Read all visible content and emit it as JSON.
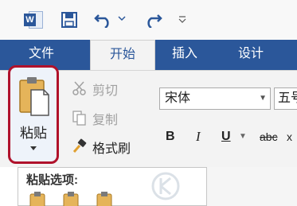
{
  "qat": {
    "app_icon": "word-icon",
    "app_icon_letter": "W",
    "save_icon": "save-icon",
    "undo_icon": "undo-icon",
    "redo_icon": "redo-icon",
    "more_icon": "customize-qat-icon"
  },
  "tabs": [
    {
      "label": "文件"
    },
    {
      "label": "开始"
    },
    {
      "label": "插入"
    },
    {
      "label": "设计"
    }
  ],
  "clipboard": {
    "paste_label": "粘贴",
    "cut_label": "剪切",
    "copy_label": "复制",
    "format_painter_label": "格式刷"
  },
  "font": {
    "name": "宋体",
    "size": "五号",
    "bold": "B",
    "italic": "I",
    "underline": "U",
    "strikethrough": "abc",
    "more": "x"
  },
  "paste_options": {
    "title": "粘贴选项:"
  },
  "colors": {
    "brand": "#2b579a",
    "highlight_border": "#b0122b",
    "ribbon": "#f3f3f3"
  }
}
